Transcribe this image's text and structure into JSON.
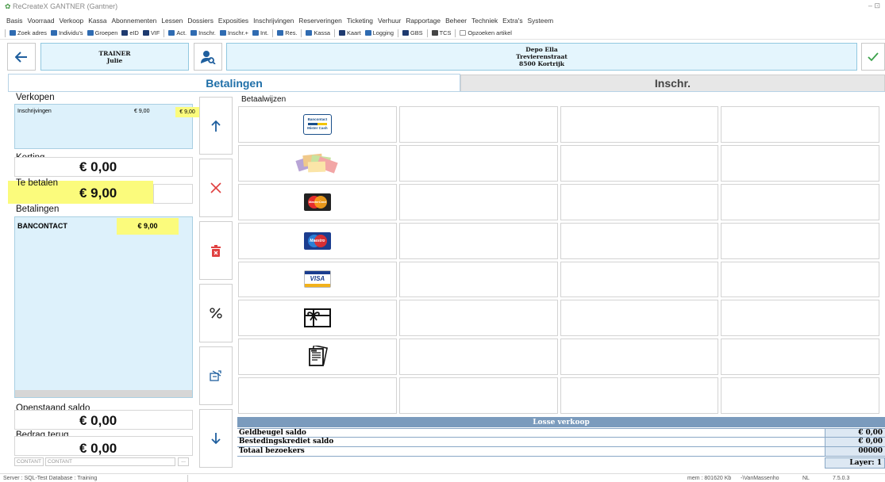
{
  "app": {
    "title": "ReCreateX GANTNER  (Gantner)",
    "window_controls": "–  ⊡"
  },
  "menu": [
    "Basis",
    "Voorraad",
    "Verkoop",
    "Kassa",
    "Abonnementen",
    "Lessen",
    "Dossiers",
    "Exposities",
    "Inschrijvingen",
    "Reserveringen",
    "Ticketing",
    "Verhuur",
    "Rapportage",
    "Beheer",
    "Techniek",
    "Extra's",
    "Systeem"
  ],
  "toolbar": [
    {
      "label": "Zoek adres",
      "color": "#2f6bb1"
    },
    {
      "label": "Individu's",
      "color": "#2f6bb1"
    },
    {
      "label": "Groepen",
      "color": "#2f6bb1"
    },
    {
      "label": "eID",
      "color": "#1e3a6f"
    },
    {
      "label": "VIF",
      "color": "#1e3a6f"
    },
    {
      "label": "Act.",
      "color": "#2f6bb1",
      "sep_before": true
    },
    {
      "label": "Inschr.",
      "color": "#2f6bb1"
    },
    {
      "label": "Inschr.+",
      "color": "#2f6bb1"
    },
    {
      "label": "Int.",
      "color": "#2f6bb1"
    },
    {
      "label": "Res.",
      "color": "#2f6bb1",
      "sep_before": true
    },
    {
      "label": "Kassa",
      "color": "#2f6bb1",
      "sep_before": true
    },
    {
      "label": "Kaart",
      "color": "#1e3a6f",
      "sep_before": true
    },
    {
      "label": "Logging",
      "color": "#2f6bb1"
    },
    {
      "label": "GBS",
      "color": "#1e3a6f",
      "sep_before": true
    },
    {
      "label": "TCS",
      "color": "#444",
      "sep_before": true
    },
    {
      "label": "Opzoeken artikel",
      "color": "#ffffff",
      "sep_before": true
    }
  ],
  "header": {
    "trainer": {
      "role": "TRAINER",
      "name": "Julie"
    },
    "location": {
      "name": "Depo Ella",
      "street": "Trevierenstraat",
      "city": "8500 Kortrijk"
    }
  },
  "tabs": {
    "betalingen": "Betalingen",
    "inschr": "Inschr."
  },
  "verkopen": {
    "label": "Verkopen",
    "items": [
      {
        "desc": "Inschrijvingen",
        "price": "€ 9,00",
        "total": "€ 9,00"
      }
    ]
  },
  "korting": {
    "label": "Korting",
    "value": "€ 0,00"
  },
  "te_betalen": {
    "label": "Te betalen",
    "value": "€ 9,00"
  },
  "betalingen": {
    "label": "Betalingen",
    "items": [
      {
        "method": "BANCONTACT",
        "amount": "€ 9,00"
      }
    ]
  },
  "openstaand": {
    "label": "Openstaand saldo",
    "value": "€ 0,00"
  },
  "bedrag_terug": {
    "label": "Bedrag terug",
    "value": "€ 0,00"
  },
  "contant": {
    "field1": "CONTANT",
    "field2": "CONTANT",
    "dots": "..."
  },
  "betaalwijzen": {
    "label": "Betaalwijzen",
    "methods": [
      "bancontact-icon",
      "cash-notes-icon",
      "mastercard-icon",
      "maestro-icon",
      "visa-icon",
      "gift-card-icon",
      "voucher-icon"
    ],
    "bancontact_text": [
      "Bancontact",
      "Mister Cash"
    ],
    "mastercard_text": "MasterCard",
    "maestro_text": "Maestro",
    "visa_text": "VISA"
  },
  "losse_verkoop": {
    "header": "Losse verkoop",
    "rows": [
      {
        "label": "Geldbeugel saldo",
        "value": "€ 0,00"
      },
      {
        "label": "Bestedingskrediet saldo",
        "value": "€ 0,00"
      },
      {
        "label": "Totaal bezoekers",
        "value": "00000"
      }
    ],
    "layer": "Layer: 1"
  },
  "status": {
    "server": "Server : SQL-Test Database : Training",
    "mem": "mem : 801620 Kb",
    "user": "-\\VanMassenho",
    "lang": "NL",
    "version": "7.5.0.3"
  },
  "colors": {
    "accent": "#1f6fa8",
    "lightblue": "#ddf1fb",
    "highlight": "#fbfb7c",
    "delete_red": "#e04040",
    "confirm_green": "#3aa14a"
  }
}
